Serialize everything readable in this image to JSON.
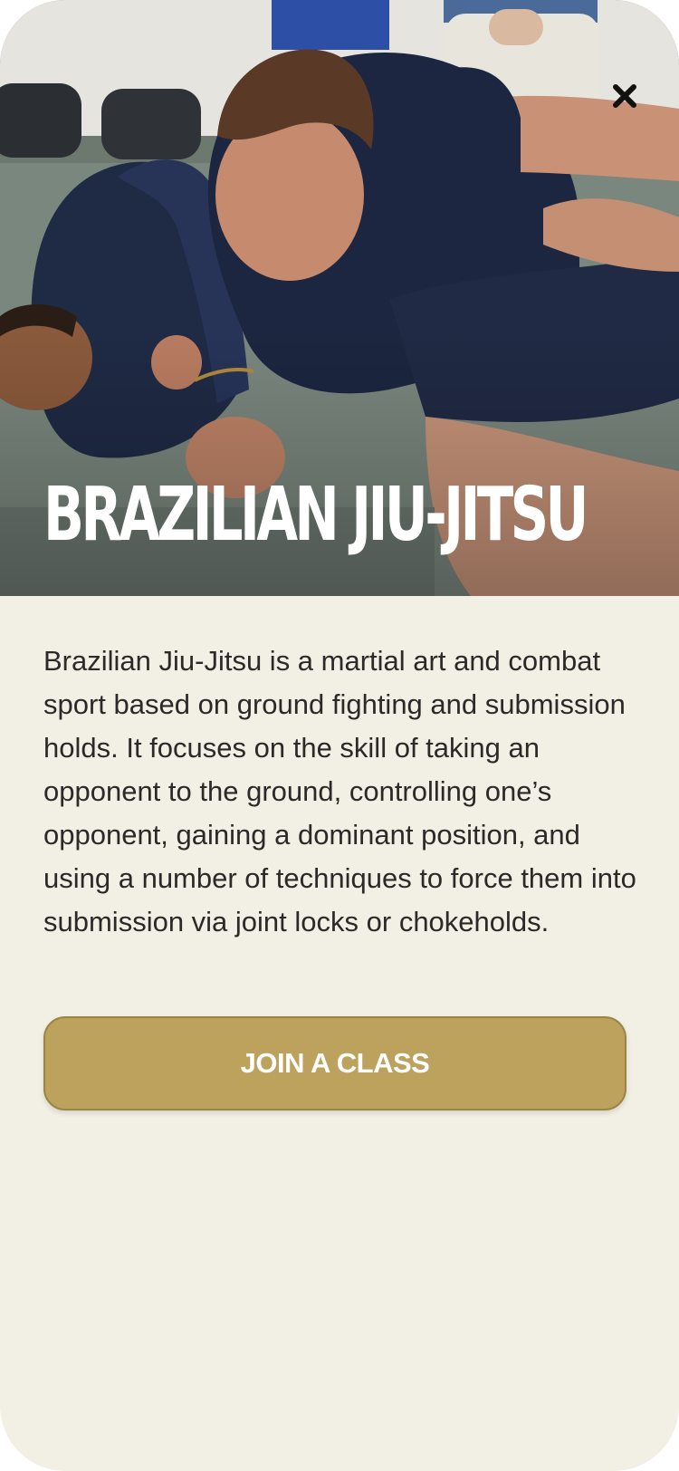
{
  "hero": {
    "image": "bjj-grappling-photo",
    "title": "BRAZILIAN JIU-JITSU",
    "close_icon": "close-icon"
  },
  "content": {
    "description": "Brazilian Jiu-Jitsu is a martial art and combat sport based on ground fighting and submission holds. It focuses on the skill of taking an opponent to the ground, controlling one’s opponent, gaining a dominant position, and using a number of techniques to force them into submission via joint locks or chokeholds."
  },
  "cta": {
    "label": "JOIN A CLASS"
  },
  "colors": {
    "background": "#f2efe4",
    "accent": "#bca25d",
    "text": "#2b2a28"
  }
}
